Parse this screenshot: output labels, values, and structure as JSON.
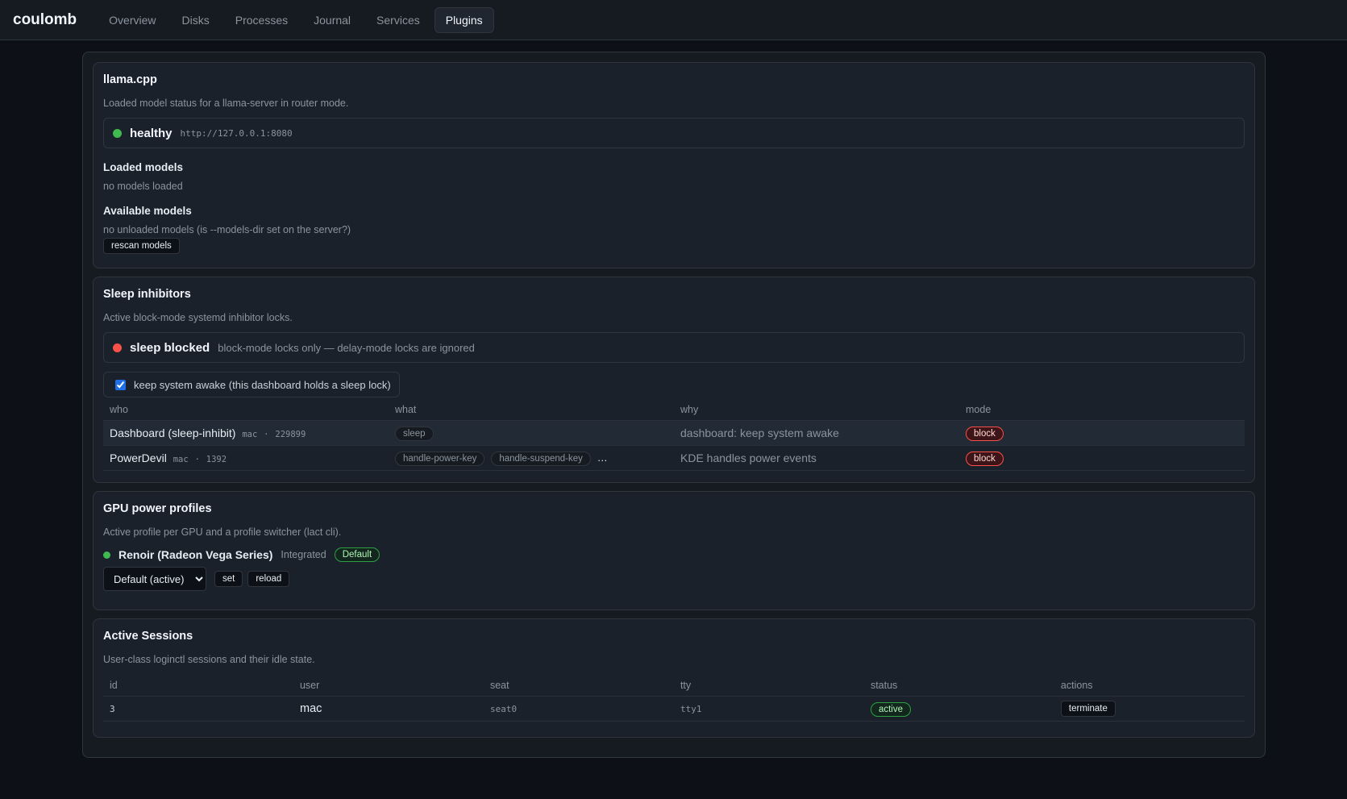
{
  "app": {
    "brand": "coulomb"
  },
  "nav": {
    "overview": "Overview",
    "disks": "Disks",
    "processes": "Processes",
    "journal": "Journal",
    "services": "Services",
    "plugins": "Plugins"
  },
  "llama": {
    "title": "llama.cpp",
    "description": "Loaded model status for a llama-server in router mode.",
    "status": "healthy",
    "url": "http://127.0.0.1:8080",
    "loaded_title": "Loaded models",
    "loaded_text": "no models loaded",
    "available_title": "Available models",
    "available_text": "no unloaded models (is --models-dir set on the server?)",
    "rescan_label": "rescan models"
  },
  "sleep": {
    "title": "Sleep inhibitors",
    "description": "Active block-mode systemd inhibitor locks.",
    "status": "sleep blocked",
    "status_note": "block-mode locks only — delay-mode locks are ignored",
    "keep_awake_label": "keep system awake (this dashboard holds a sleep lock)",
    "columns": {
      "who": "who",
      "what": "what",
      "why": "why",
      "mode": "mode"
    },
    "rows": [
      {
        "who": "Dashboard (sleep-inhibit)",
        "user": "mac",
        "pid": "229899",
        "what": [
          "sleep"
        ],
        "more": "",
        "why": "dashboard: keep system awake",
        "mode": "block"
      },
      {
        "who": "PowerDevil",
        "user": "mac",
        "pid": "1392",
        "what": [
          "handle-power-key",
          "handle-suspend-key"
        ],
        "more": "…",
        "why": "KDE handles power events",
        "mode": "block"
      }
    ]
  },
  "gpu": {
    "title": "GPU power profiles",
    "description": "Active profile per GPU and a profile switcher (lact cli).",
    "name": "Renoir (Radeon Vega Series)",
    "type": "Integrated",
    "badge": "Default",
    "select_value": "Default (active)",
    "set_label": "set",
    "reload_label": "reload"
  },
  "sessions": {
    "title": "Active Sessions",
    "description": "User-class loginctl sessions and their idle state.",
    "columns": {
      "id": "id",
      "user": "user",
      "seat": "seat",
      "tty": "tty",
      "status": "status",
      "actions": "actions"
    },
    "rows": [
      {
        "id": "3",
        "user": "mac",
        "seat": "seat0",
        "tty": "tty1",
        "status": "active",
        "action": "terminate"
      }
    ]
  },
  "colors": {
    "healthy": "#3fb950",
    "blocked": "#f85149"
  }
}
